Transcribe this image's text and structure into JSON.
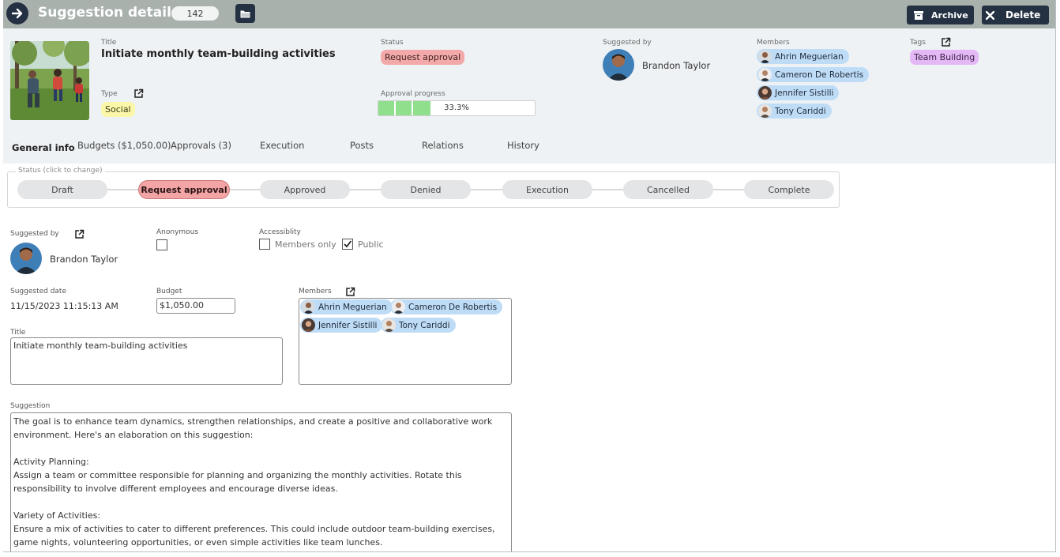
{
  "topbar": {
    "title": "Suggestion details",
    "count": "142",
    "archive_label": "Archive",
    "delete_label": "Delete"
  },
  "header": {
    "title_label": "Title",
    "title": "Initiate monthly team-building activities",
    "status_label": "Status",
    "status": "Request approval",
    "type_label": "Type",
    "type": "Social",
    "progress_label": "Approval progress",
    "progress_value": 0.333,
    "progress_text": "33.3%",
    "suggested_by_label": "Suggested by",
    "suggested_by": "Brandon Taylor",
    "members_label": "Members",
    "members": [
      "Ahrin Meguerian",
      "Cameron De Robertis",
      "Jennifer Sistilli",
      "Tony Cariddi"
    ],
    "tags_label": "Tags",
    "tags": [
      "Team Building"
    ]
  },
  "tabs": [
    "General info",
    "Budgets ($1,050.00)",
    "Approvals (3)",
    "Execution",
    "Posts",
    "Relations",
    "History"
  ],
  "stepper": {
    "legend": "Status (click to change)",
    "steps": [
      "Draft",
      "Request approval",
      "Approved",
      "Denied",
      "Execution",
      "Cancelled",
      "Complete"
    ],
    "active": "Request approval"
  },
  "form": {
    "suggested_by_label": "Suggested by",
    "suggested_by": "Brandon Taylor",
    "anonymous_label": "Anonymous",
    "anonymous": false,
    "accessibility_label": "Accessiblity",
    "members_only_label": "Members only",
    "members_only": false,
    "public_label": "Public",
    "public": true,
    "suggested_date_label": "Suggested date",
    "suggested_date": "11/15/2023 11:15:13 AM",
    "budget_label": "Budget",
    "budget": "$1,050.00",
    "members_label": "Members",
    "members": [
      "Ahrin Meguerian",
      "Cameron De Robertis",
      "Jennifer Sistilli",
      "Tony Cariddi"
    ],
    "title_label": "Title",
    "title": "Initiate monthly team-building activities",
    "suggestion_label": "Suggestion",
    "suggestion": "The goal is to enhance team dynamics, strengthen relationships, and create a positive and collaborative work environment. Here's an elaboration on this suggestion:\n\nActivity Planning:\nAssign a team or committee responsible for planning and organizing the monthly activities. Rotate this responsibility to involve different employees and encourage diverse ideas.\n\nVariety of Activities:\nEnsure a mix of activities to cater to different preferences. This could include outdoor team-building exercises, game nights, volunteering opportunities, or even simple activities like team lunches."
  },
  "colors": {
    "topbar": "#a9b1ad",
    "dark_button": "#233142",
    "status_red": "#f3a9a9",
    "type_yellow": "#fbf7a8",
    "tag_purple": "#e3b8f4",
    "member_blue": "#bfdcf7",
    "progress_green": "#8fdf8d"
  },
  "icons": [
    "arrow-right-icon",
    "folder-icon",
    "archive-icon",
    "close-icon",
    "external-link-icon",
    "checkmark-icon"
  ]
}
